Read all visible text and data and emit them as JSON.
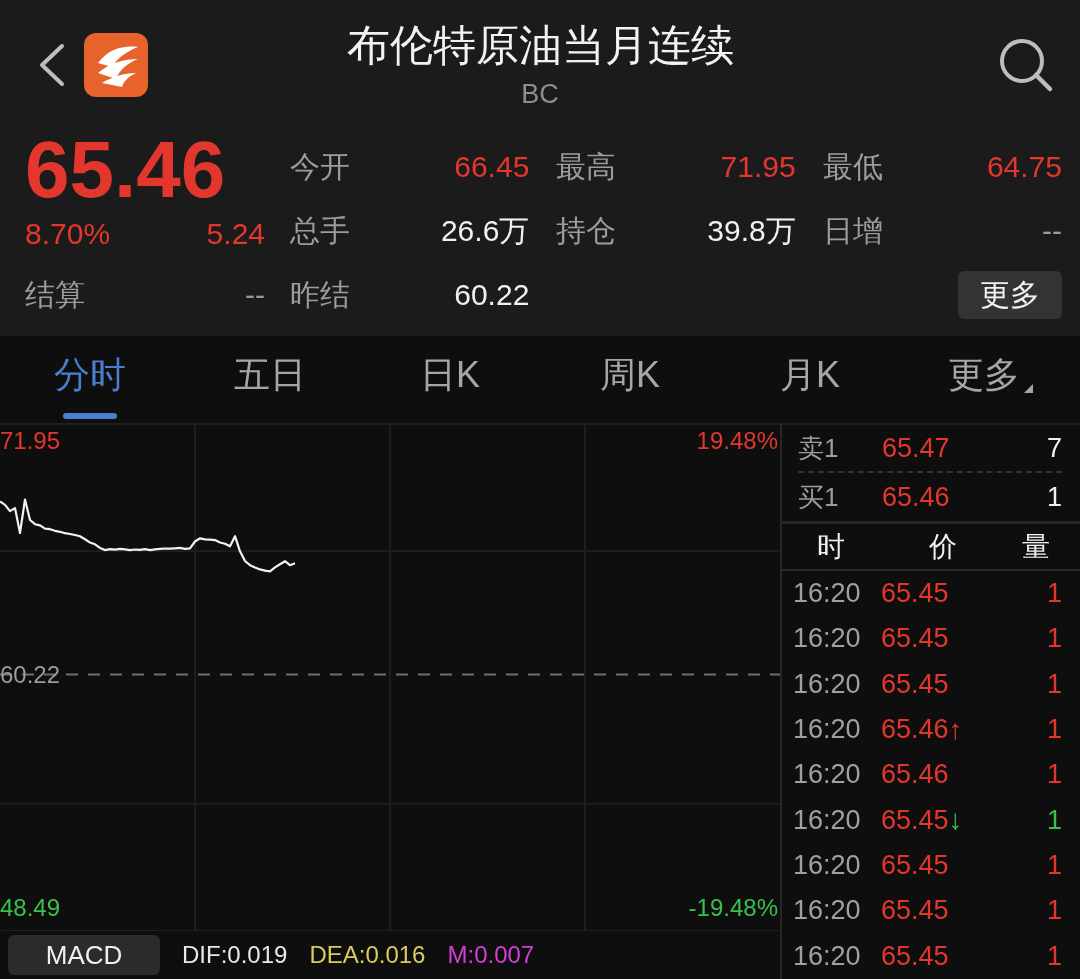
{
  "header": {
    "title": "布伦特原油当月连续",
    "code": "BC"
  },
  "quote": {
    "price": "65.46",
    "change_percent": "8.70%",
    "change": "5.24",
    "settlement": {
      "label": "结算",
      "value": "--"
    }
  },
  "stats": [
    {
      "label": "今开",
      "value": "66.45",
      "color": "#e3372e"
    },
    {
      "label": "最高",
      "value": "71.95",
      "color": "#e3372e"
    },
    {
      "label": "最低",
      "value": "64.75",
      "color": "#e3372e"
    },
    {
      "label": "总手",
      "value": "26.6万",
      "color": "#f0f0f0"
    },
    {
      "label": "持仓",
      "value": "39.8万",
      "color": "#f0f0f0"
    },
    {
      "label": "日增",
      "value": "--",
      "color": "#9a9a9a"
    },
    {
      "label": "昨结",
      "value": "60.22",
      "color": "#f0f0f0"
    }
  ],
  "more_button": "更多",
  "tabs": [
    {
      "label": "分时",
      "selected": true,
      "dropdown": false
    },
    {
      "label": "五日",
      "selected": false,
      "dropdown": false
    },
    {
      "label": "日K",
      "selected": false,
      "dropdown": false
    },
    {
      "label": "周K",
      "selected": false,
      "dropdown": false
    },
    {
      "label": "月K",
      "selected": false,
      "dropdown": false
    },
    {
      "label": "更多",
      "selected": false,
      "dropdown": true
    }
  ],
  "chart": {
    "chart_data": {
      "type": "line",
      "ylim": [
        48.49,
        71.95
      ],
      "yticks": [
        {
          "value": 71.95,
          "label": "71.95"
        },
        {
          "value": 48.49,
          "label": "48.49"
        }
      ],
      "ref_lines": [
        {
          "axis": "y",
          "value": 60.22,
          "label": "60.22"
        }
      ],
      "values": [
        68.91,
        68.74,
        68.43,
        68.58,
        67.33,
        69.01,
        67.98,
        67.77,
        67.71,
        67.55,
        67.52,
        67.44,
        67.39,
        67.32,
        67.28,
        67.23,
        67.17,
        67.01,
        66.85,
        66.76,
        66.58,
        66.47,
        66.52,
        66.49,
        66.53,
        66.51,
        66.47,
        66.5,
        66.48,
        66.52,
        66.47,
        66.51,
        66.53,
        66.55,
        66.54,
        66.56,
        66.58,
        66.53,
        66.56,
        66.9,
        67.06,
        67.01,
        66.99,
        66.97,
        66.85,
        66.79,
        66.66,
        67.17,
        66.41,
        65.92,
        65.71,
        65.6,
        65.5,
        65.44,
        65.4,
        65.6,
        65.76,
        65.91,
        65.71,
        65.81,
        null,
        null,
        null,
        null,
        null,
        null,
        null,
        null,
        null,
        null,
        null,
        null,
        null,
        null,
        null,
        null,
        null,
        null,
        null,
        null,
        null,
        null,
        null,
        null,
        null,
        null,
        null,
        null,
        null,
        null,
        null,
        null,
        null,
        null,
        null,
        null,
        null,
        null,
        null,
        null,
        null,
        null,
        null,
        null,
        null,
        null,
        null,
        null,
        null,
        null,
        null,
        null,
        null,
        null,
        null,
        null,
        null,
        null,
        null,
        null,
        null,
        null,
        null,
        null,
        null,
        null,
        null,
        null,
        null,
        null,
        null,
        null,
        null,
        null,
        null,
        null,
        null,
        null,
        null,
        null,
        null,
        null,
        null,
        null,
        null,
        null,
        null,
        null,
        null,
        null,
        null,
        null,
        null,
        null,
        null,
        null,
        null
      ],
      "annotations": [
        "19.48%",
        "-19.48%"
      ]
    }
  },
  "indicator": {
    "button": "MACD",
    "values": [
      {
        "text": "DIF:0.019",
        "color": "#e8e8e8"
      },
      {
        "text": "DEA:0.016",
        "color": "#d9cb5e"
      },
      {
        "text": "M:0.007",
        "color": "#d23fd6"
      }
    ]
  },
  "order_book": [
    {
      "label": "卖1",
      "price": "65.47",
      "volume": "7"
    },
    {
      "label": "买1",
      "price": "65.46",
      "volume": "1"
    }
  ],
  "trades": {
    "columns": [
      "时",
      "价",
      "量"
    ],
    "rows": [
      {
        "time": "16:20",
        "price": "65.45",
        "volume": "1",
        "color": "#e3372e"
      },
      {
        "time": "16:20",
        "price": "65.45",
        "volume": "1",
        "color": "#e3372e"
      },
      {
        "time": "16:20",
        "price": "65.45",
        "volume": "1",
        "color": "#e3372e"
      },
      {
        "time": "16:20",
        "price": "65.46",
        "arrow": "↑",
        "volume": "1",
        "color": "#e3372e"
      },
      {
        "time": "16:20",
        "price": "65.46",
        "volume": "1",
        "color": "#e3372e"
      },
      {
        "time": "16:20",
        "price": "65.45",
        "arrow": "↓",
        "volume": "1",
        "color": "#37c24a"
      },
      {
        "time": "16:20",
        "price": "65.45",
        "volume": "1",
        "color": "#e3372e"
      },
      {
        "time": "16:20",
        "price": "65.45",
        "volume": "1",
        "color": "#e3372e"
      },
      {
        "time": "16:20",
        "price": "65.45",
        "volume": "1",
        "color": "#e3372e"
      }
    ]
  }
}
